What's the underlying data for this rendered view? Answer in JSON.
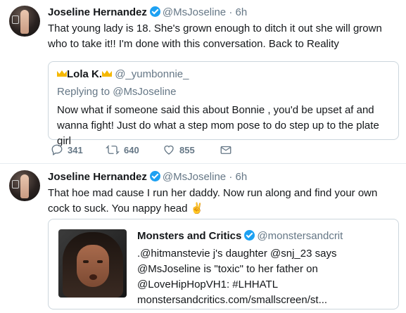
{
  "tweets": [
    {
      "name": "Joseline Hernandez",
      "handle": "@MsJoseline",
      "dot": "·",
      "time": "6h",
      "text": "That young lady is 18. She's grown enough to ditch it out she will grown who to take it!! I'm done with this conversation. Back to Reality",
      "quoted": {
        "name": "Lola K.",
        "handle": "@_yumbonnie_",
        "replying_to": "Replying to @MsJoseline",
        "text": "Now what if someone said this about Bonnie , you'd be upset af and wanna fight! Just do what a step mom pose to do step up to the plate girl"
      },
      "actions": {
        "replies": "341",
        "retweets": "640",
        "likes": "855"
      }
    },
    {
      "name": "Joseline Hernandez",
      "handle": "@MsJoseline",
      "dot": "·",
      "time": "6h",
      "text": "That hoe mad cause I run her daddy. Now run along and find your own cock to suck.  You nappy head ✌️",
      "card": {
        "name": "Monsters and Critics",
        "handle": "@monstersandcrit",
        "text": ".@hitmanstevie j's daughter @snj_23 says @MsJoseline is \"toxic\" to her father on @LoveHipHopVH1: #LHHATL monstersandcritics.com/smallscreen/st..."
      }
    }
  ],
  "colors": {
    "verified": "#1da1f2",
    "secondary_text": "#657786",
    "border": "#ccd6dd",
    "crown": "#f5b800"
  }
}
